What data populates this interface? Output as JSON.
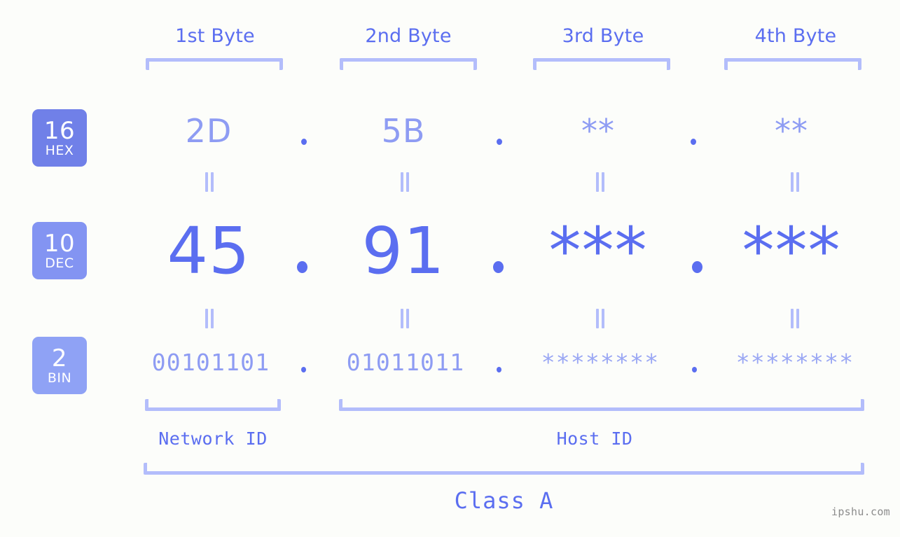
{
  "colors": {
    "background": "#fcfdfa",
    "accent_strong": "#5b6ef0",
    "accent_light": "#8e9cf3",
    "bracket": "#b3bdfb",
    "badge_hex": "#7080e8",
    "badge_dec": "#8394f2",
    "badge_bin": "#8fa2f5",
    "watermark": "#8c8c8c"
  },
  "byte_headers": [
    {
      "label": "1st Byte"
    },
    {
      "label": "2nd Byte"
    },
    {
      "label": "3rd Byte"
    },
    {
      "label": "4th Byte"
    }
  ],
  "bases": [
    {
      "number": "16",
      "name": "HEX"
    },
    {
      "number": "10",
      "name": "DEC"
    },
    {
      "number": "2",
      "name": "BIN"
    }
  ],
  "separator": ".",
  "rows": {
    "hex": {
      "values": [
        "2D",
        "5B",
        "**",
        "**"
      ]
    },
    "dec": {
      "values": [
        "45",
        "91",
        "***",
        "***"
      ]
    },
    "bin": {
      "values": [
        "00101101",
        "01011011",
        "********",
        "********"
      ]
    }
  },
  "id_sections": [
    {
      "label": "Network ID"
    },
    {
      "label": "Host ID"
    }
  ],
  "class": {
    "label": "Class A"
  },
  "watermark": {
    "text": "ipshu.com"
  }
}
